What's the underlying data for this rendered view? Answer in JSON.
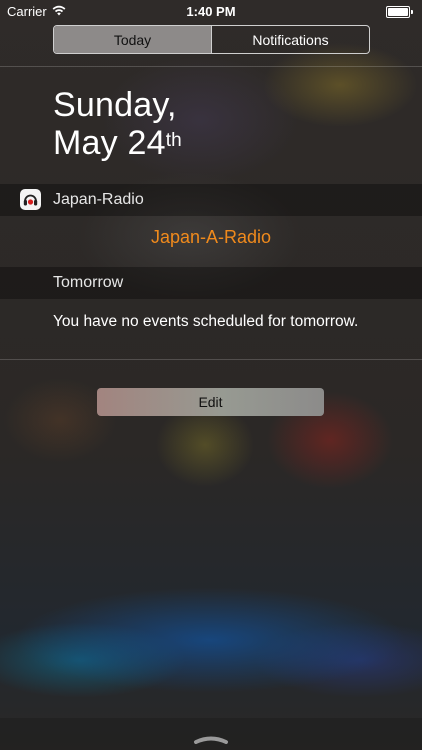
{
  "status_bar": {
    "carrier": "Carrier",
    "time": "1:40 PM",
    "wifi_icon": "wifi-icon",
    "battery_icon": "battery-icon"
  },
  "tabs": [
    {
      "label": "Today",
      "selected": true
    },
    {
      "label": "Notifications",
      "selected": false
    }
  ],
  "date": {
    "weekday": "Sunday,",
    "month_day": "May 24",
    "ordinal": "th"
  },
  "widgets": {
    "japan_radio": {
      "title": "Japan-Radio",
      "icon": "japan-radio-app-icon",
      "link_label": "Japan-A-Radio",
      "link_color": "#F08A1C"
    },
    "tomorrow": {
      "title": "Tomorrow",
      "message": "You have no events scheduled for tomorrow."
    }
  },
  "edit_button": {
    "label": "Edit"
  },
  "grabber_icon": "chevron-grabber-icon"
}
